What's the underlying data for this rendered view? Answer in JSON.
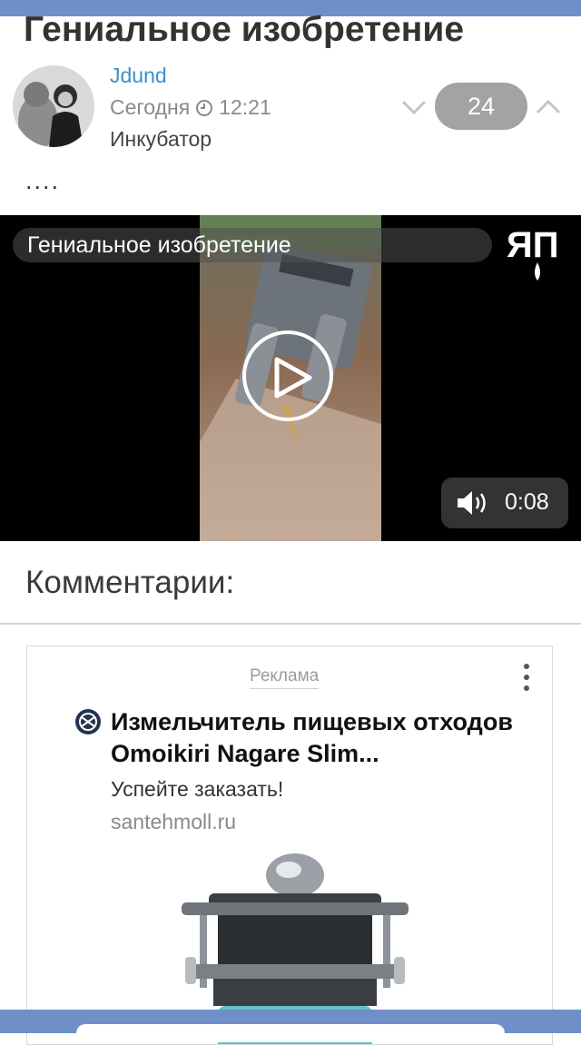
{
  "post": {
    "title": "Гениальное изобретение",
    "author": "Jdund",
    "date": "Сегодня",
    "time": "12:21",
    "community": "Инкубатор",
    "rating": "24",
    "text": "...."
  },
  "video": {
    "title": "Гениальное изобретение",
    "logo_text": "ЯП",
    "duration": "0:08"
  },
  "comments": {
    "heading": "Комментарии:"
  },
  "ad": {
    "label": "Реклама",
    "headline": "Измельчитель пищевых отходов Omoikiri Nagare Slim...",
    "subtitle": "Успейте заказать!",
    "domain": "santehmoll.ru"
  },
  "colors": {
    "header_bar": "#6f8fc9",
    "author_link": "#3d8ec8",
    "rating_pill": "#a3a3a3",
    "product_teal": "#5ec6c0"
  },
  "icons": [
    "clock-icon",
    "chevron-down-icon",
    "chevron-up-icon",
    "play-icon",
    "speaker-icon",
    "more-vertical-icon"
  ]
}
